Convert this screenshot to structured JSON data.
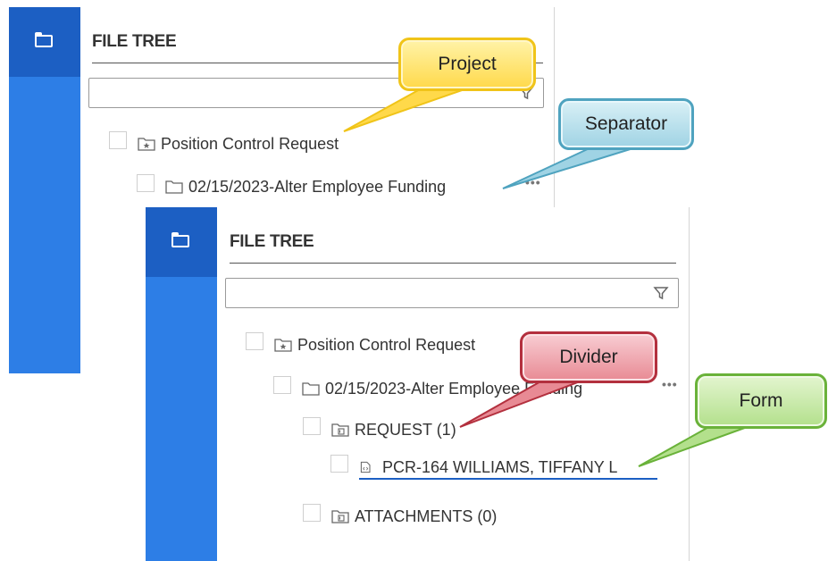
{
  "back_panel": {
    "title": "FILE TREE",
    "search": {
      "value": "",
      "placeholder": ""
    },
    "tree": [
      {
        "label": "Position Control Request",
        "icon": "project-folder-icon"
      },
      {
        "label": "02/15/2023-Alter Employee Funding",
        "icon": "folder-icon",
        "menu": "•••"
      }
    ]
  },
  "front_panel": {
    "title": "FILE TREE",
    "search": {
      "value": "",
      "placeholder": ""
    },
    "tree": [
      {
        "label": "Position Control Request",
        "icon": "project-folder-icon"
      },
      {
        "label": "02/15/2023-Alter Employee Funding",
        "icon": "folder-icon",
        "menu": "•••"
      },
      {
        "label": "REQUEST (1)",
        "icon": "divider-folder-icon"
      },
      {
        "label": "PCR-164 WILLIAMS, TIFFANY L",
        "icon": "form-file-icon"
      },
      {
        "label": "ATTACHMENTS (0)",
        "icon": "divider-folder-icon"
      }
    ]
  },
  "callouts": {
    "project": "Project",
    "separator": "Separator",
    "divider": "Divider",
    "form": "Form"
  },
  "colors": {
    "rail": "#2d7ee6",
    "rail_active": "#1c5fc3",
    "project_callout": "#ffd94a",
    "separator_callout": "#9fd3e4",
    "divider_callout": "#e88a94",
    "form_callout": "#b3e08c"
  }
}
